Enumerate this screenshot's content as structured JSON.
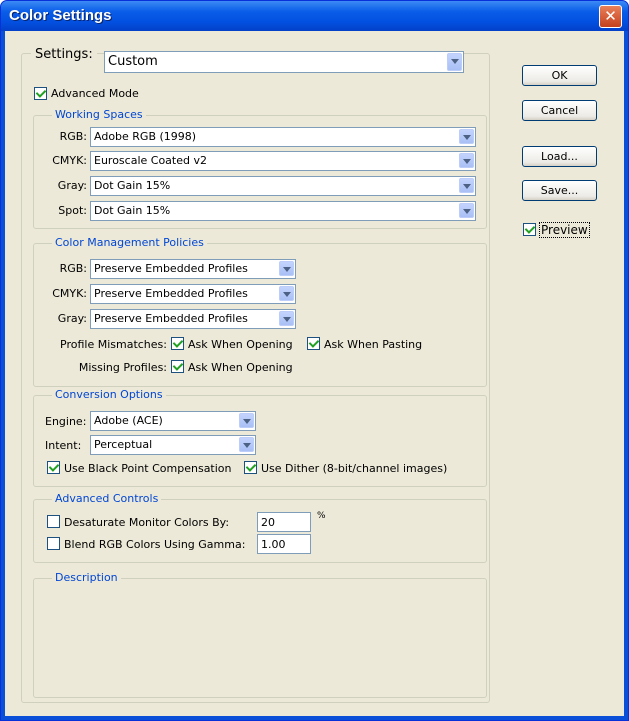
{
  "window": {
    "title": "Color Settings"
  },
  "settings": {
    "label": "Settings:",
    "value": "Custom"
  },
  "advanced_mode": {
    "label": "Advanced Mode",
    "checked": true
  },
  "working_spaces": {
    "legend": "Working Spaces",
    "rows": [
      {
        "label": "RGB:",
        "value": "Adobe RGB (1998)"
      },
      {
        "label": "CMYK:",
        "value": "Euroscale Coated v2"
      },
      {
        "label": "Gray:",
        "value": "Dot Gain 15%"
      },
      {
        "label": "Spot:",
        "value": "Dot Gain 15%"
      }
    ]
  },
  "policies": {
    "legend": "Color Management Policies",
    "rows": [
      {
        "label": "RGB:",
        "value": "Preserve Embedded Profiles"
      },
      {
        "label": "CMYK:",
        "value": "Preserve Embedded Profiles"
      },
      {
        "label": "Gray:",
        "value": "Preserve Embedded Profiles"
      }
    ],
    "mismatches_label": "Profile Mismatches:",
    "ask_opening": "Ask When Opening",
    "ask_pasting": "Ask When Pasting",
    "missing_label": "Missing Profiles:",
    "missing_ask_opening": "Ask When Opening"
  },
  "conversion": {
    "legend": "Conversion Options",
    "engine_label": "Engine:",
    "engine_value": "Adobe (ACE)",
    "intent_label": "Intent:",
    "intent_value": "Perceptual",
    "black_point": "Use Black Point Compensation",
    "dither": "Use Dither (8-bit/channel images)"
  },
  "advanced_controls": {
    "legend": "Advanced Controls",
    "desaturate_label": "Desaturate Monitor Colors By:",
    "desaturate_value": "20",
    "percent": "%",
    "blend_label": "Blend RGB Colors Using Gamma:",
    "blend_value": "1.00"
  },
  "description": {
    "legend": "Description"
  },
  "buttons": {
    "ok": "OK",
    "cancel": "Cancel",
    "load": "Load...",
    "save": "Save...",
    "preview": "Preview"
  }
}
